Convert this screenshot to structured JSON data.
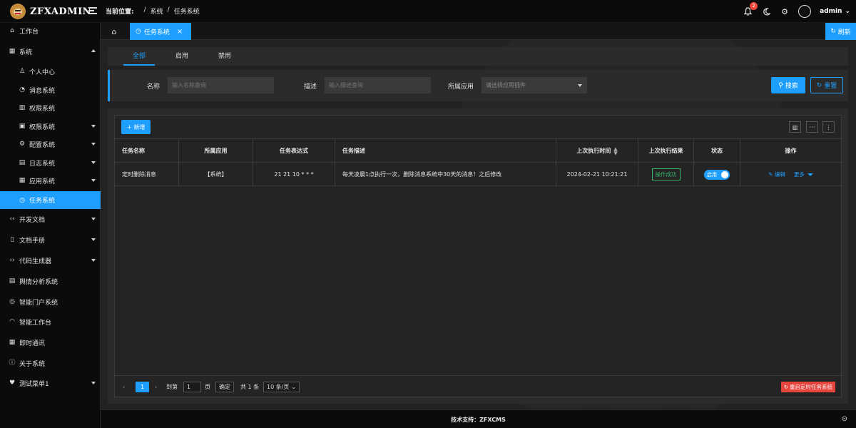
{
  "header": {
    "brand": "ZFXADMIN",
    "breadcrumb_label": "当前位置:",
    "breadcrumb": [
      "/",
      "系统",
      "/",
      "任务系统"
    ],
    "notification_count": "2",
    "username": "admin"
  },
  "sidebar": {
    "items": [
      {
        "label": "工作台",
        "icon": "home-icon",
        "glyph": "⌂"
      },
      {
        "label": "系统",
        "icon": "grid-icon",
        "glyph": "▦"
      },
      {
        "label": "个人中心",
        "icon": "user-icon",
        "glyph": "♙"
      },
      {
        "label": "消息系统",
        "icon": "bell-icon",
        "glyph": "◔"
      },
      {
        "label": "权限系统",
        "icon": "key-icon",
        "glyph": "▥"
      },
      {
        "label": "权限系统",
        "icon": "lock-icon",
        "glyph": "🔒"
      },
      {
        "label": "配置系统",
        "icon": "gear-icon",
        "glyph": "⚙"
      },
      {
        "label": "日志系统",
        "icon": "log-icon",
        "glyph": "▤"
      },
      {
        "label": "应用系统",
        "icon": "app-icon",
        "glyph": "▦"
      },
      {
        "label": "任务系统",
        "icon": "clock-icon",
        "glyph": "◷"
      },
      {
        "label": "开发文档",
        "icon": "code-icon",
        "glyph": "‹›"
      },
      {
        "label": "文档手册",
        "icon": "doc-icon",
        "glyph": "▯"
      },
      {
        "label": "代码生成器",
        "icon": "code-gen-icon",
        "glyph": "‹›"
      },
      {
        "label": "舆情分析系统",
        "icon": "analysis-icon",
        "glyph": "▤"
      },
      {
        "label": "智能门户系统",
        "icon": "globe-icon",
        "glyph": "◎"
      },
      {
        "label": "智能工作台",
        "icon": "dashboard-icon",
        "glyph": "◠"
      },
      {
        "label": "即时通讯",
        "icon": "chat-icon",
        "glyph": "▦"
      },
      {
        "label": "关于系统",
        "icon": "info-icon",
        "glyph": "ⓘ"
      },
      {
        "label": "测试菜单1",
        "icon": "heart-icon",
        "glyph": "♥"
      }
    ]
  },
  "tabbar": {
    "home_glyph": "⌂",
    "current_tab": "任务系统",
    "close_glyph": "×",
    "refresh": "刷新"
  },
  "filter_tabs": [
    "全部",
    "启用",
    "禁用"
  ],
  "search": {
    "name_label": "名称",
    "name_placeholder": "输入名称查询",
    "desc_label": "描述",
    "desc_placeholder": "输入描述查询",
    "app_label": "所属应用",
    "app_placeholder": "请选择应用插件",
    "search_btn": "搜索",
    "reset_btn": "重置"
  },
  "table": {
    "add_btn": "新增",
    "columns": [
      "任务名称",
      "所属应用",
      "任务表达式",
      "任务描述",
      "上次执行时间",
      "上次执行结果",
      "状态",
      "操作"
    ],
    "rows": [
      {
        "name": "定时删除消息",
        "app": "【系统】",
        "expr": "21 21 10 * * *",
        "desc": "每天凌晨1点执行一次，删除消息系统中30天的消息！之后修改",
        "last_time": "2024-02-21 10:21:21",
        "last_result": "操作成功",
        "status": "启用",
        "edit": "编辑",
        "more": "更多"
      }
    ]
  },
  "pager": {
    "prev": "‹",
    "current": "1",
    "next": "›",
    "goto_label": "到第",
    "goto_value": "1",
    "page_unit": "页",
    "confirm": "确定",
    "total": "共 1 条",
    "page_size": "10 条/页",
    "restart_btn": "重启定时任务系统"
  },
  "footer": {
    "support": "技术支持：ZFXCMS"
  },
  "colors": {
    "accent": "#1e9fff",
    "success": "#35b56a",
    "danger": "#e5433b"
  }
}
